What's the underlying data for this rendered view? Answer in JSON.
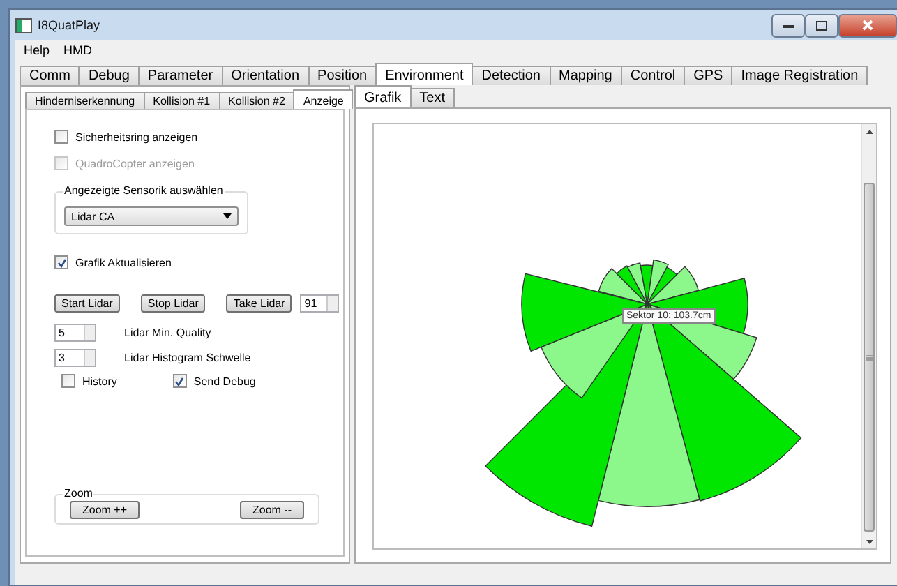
{
  "window": {
    "title": "I8QuatPlay"
  },
  "menu": [
    "Help",
    "HMD"
  ],
  "main_tabs": [
    {
      "label": "Comm",
      "selected": false
    },
    {
      "label": "Debug",
      "selected": false
    },
    {
      "label": "Parameter",
      "selected": false
    },
    {
      "label": "Orientation",
      "selected": false
    },
    {
      "label": "Position",
      "selected": false
    },
    {
      "label": "Environment",
      "selected": true
    },
    {
      "label": "Detection",
      "selected": false
    },
    {
      "label": "Mapping",
      "selected": false
    },
    {
      "label": "Control",
      "selected": false
    },
    {
      "label": "GPS",
      "selected": false
    },
    {
      "label": "Image Registration",
      "selected": false
    }
  ],
  "sub_tabs": [
    {
      "label": "Hinderniserkennung",
      "selected": false
    },
    {
      "label": "Kollision #1",
      "selected": false
    },
    {
      "label": "Kollision #2",
      "selected": false
    },
    {
      "label": "Anzeige",
      "selected": true
    }
  ],
  "display_options": [
    {
      "label": "Sicherheitsring anzeigen",
      "checked": false,
      "disabled": false
    },
    {
      "label": "QuadroCopter anzeigen",
      "checked": false,
      "disabled": true
    }
  ],
  "sensor_group": {
    "title": "Angezeigte Sensorik auswählen",
    "dropdown": "Lidar CA"
  },
  "update_option": {
    "label": "Grafik Aktualisieren",
    "checked": true,
    "disabled": false
  },
  "lidar_buttons": [
    "Start Lidar",
    "Stop Lidar",
    "Take Lidar"
  ],
  "take_count": "91",
  "spin_rows": [
    {
      "value": "5",
      "label": "Lidar Min. Quality"
    },
    {
      "value": "3",
      "label": "Lidar Histogram Schwelle"
    }
  ],
  "extra_options": [
    {
      "label": "History",
      "checked": false,
      "disabled": false
    },
    {
      "label": "Send Debug",
      "checked": true,
      "disabled": false
    }
  ],
  "zoom_group": {
    "title": "Zoom",
    "buttons": [
      "Zoom ++",
      "Zoom --"
    ]
  },
  "view_tabs": [
    {
      "label": "Grafik",
      "selected": true
    },
    {
      "label": "Text",
      "selected": false
    }
  ],
  "tooltip": "Sektor 10: 103.7cm"
}
